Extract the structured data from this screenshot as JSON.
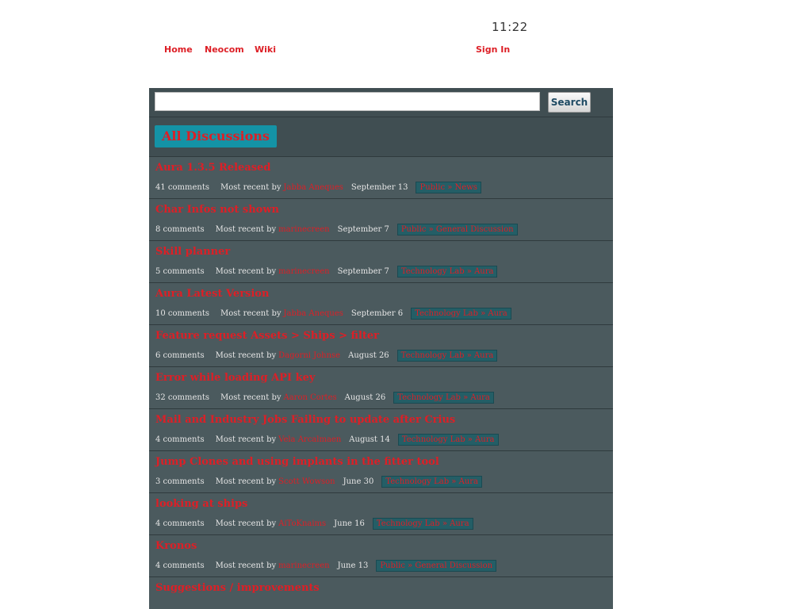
{
  "clock": "11:22",
  "nav": {
    "home": "Home",
    "neocom": "Neocom",
    "wiki": "Wiki",
    "sign_in": "Sign In"
  },
  "search": {
    "value": "",
    "button_label": "Search"
  },
  "heading": "All Discussions",
  "most_recent_label": "Most recent by",
  "discussions": [
    {
      "title": "Aura 1.3.5 Released",
      "comments": "41 comments",
      "user": "Jabba Aneques",
      "date": "September 13",
      "category": "Public » News"
    },
    {
      "title": "Char Infos not shown",
      "comments": "8 comments",
      "user": "marinecreen",
      "date": "September 7",
      "category": "Public » General Discussion"
    },
    {
      "title": "Skill planner",
      "comments": "5 comments",
      "user": "marinecreen",
      "date": "September 7",
      "category": "Technology Lab » Aura"
    },
    {
      "title": "Aura Latest Version",
      "comments": "10 comments",
      "user": "Jabba Aneques",
      "date": "September 6",
      "category": "Technology Lab » Aura"
    },
    {
      "title": "Feature request Assets > Ships > filter",
      "comments": "6 comments",
      "user": "Dagorni Johnse",
      "date": "August 26",
      "category": "Technology Lab » Aura"
    },
    {
      "title": "Error while loading API key",
      "comments": "32 comments",
      "user": "Aaron Cortes",
      "date": "August 26",
      "category": "Technology Lab » Aura"
    },
    {
      "title": "Mail and Industry Jobs Failing to update after Crius",
      "comments": "4 comments",
      "user": "Vela Arcalmaen",
      "date": "August 14",
      "category": "Technology Lab » Aura"
    },
    {
      "title": "Jump Clones and using implants in the fitter tool",
      "comments": "3 comments",
      "user": "Scott Wowson",
      "date": "June 30",
      "category": "Technology Lab » Aura"
    },
    {
      "title": "looking at ships",
      "comments": "4 comments",
      "user": "AiToKnaims",
      "date": "June 16",
      "category": "Technology Lab » Aura"
    },
    {
      "title": "Kronos",
      "comments": "4 comments",
      "user": "marinecreen",
      "date": "June 13",
      "category": "Public » General Discussion"
    },
    {
      "title": "Suggestions / improvements",
      "comments": "",
      "user": "",
      "date": "",
      "category": ""
    }
  ]
}
